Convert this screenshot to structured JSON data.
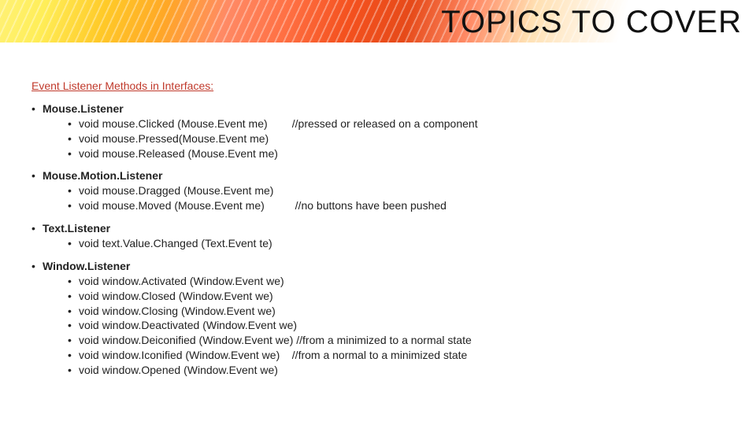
{
  "title": "TOPICS TO COVER",
  "sectionTitle": "Event Listener Methods in Interfaces:",
  "groups": [
    {
      "name": "Mouse.Listener",
      "items": [
        {
          "method": "void mouse.Clicked (Mouse.Event me)",
          "comment": "        //pressed or released on a component"
        },
        {
          "method": "void mouse.Pressed(Mouse.Event me)",
          "comment": ""
        },
        {
          "method": "void mouse.Released (Mouse.Event me)",
          "comment": ""
        }
      ]
    },
    {
      "name": "Mouse.Motion.Listener",
      "items": [
        {
          "method": "void mouse.Dragged (Mouse.Event me)",
          "comment": ""
        },
        {
          "method": "void mouse.Moved (Mouse.Event me)",
          "comment": "          //no buttons have been pushed"
        }
      ]
    },
    {
      "name": "Text.Listener",
      "items": [
        {
          "method": "void text.Value.Changed (Text.Event te)",
          "comment": ""
        }
      ]
    },
    {
      "name": "Window.Listener",
      "items": [
        {
          "method": "void window.Activated (Window.Event we)",
          "comment": ""
        },
        {
          "method": "void window.Closed (Window.Event we)",
          "comment": ""
        },
        {
          "method": "void window.Closing (Window.Event we)",
          "comment": ""
        },
        {
          "method": "void window.Deactivated (Window.Event we)",
          "comment": ""
        },
        {
          "method": "void window.Deiconified (Window.Event we)",
          "comment": " //from a minimized to a normal state"
        },
        {
          "method": "void window.Iconified (Window.Event we)",
          "comment": "    //from a normal to a minimized state"
        },
        {
          "method": "void window.Opened (Window.Event we)",
          "comment": ""
        }
      ]
    }
  ]
}
